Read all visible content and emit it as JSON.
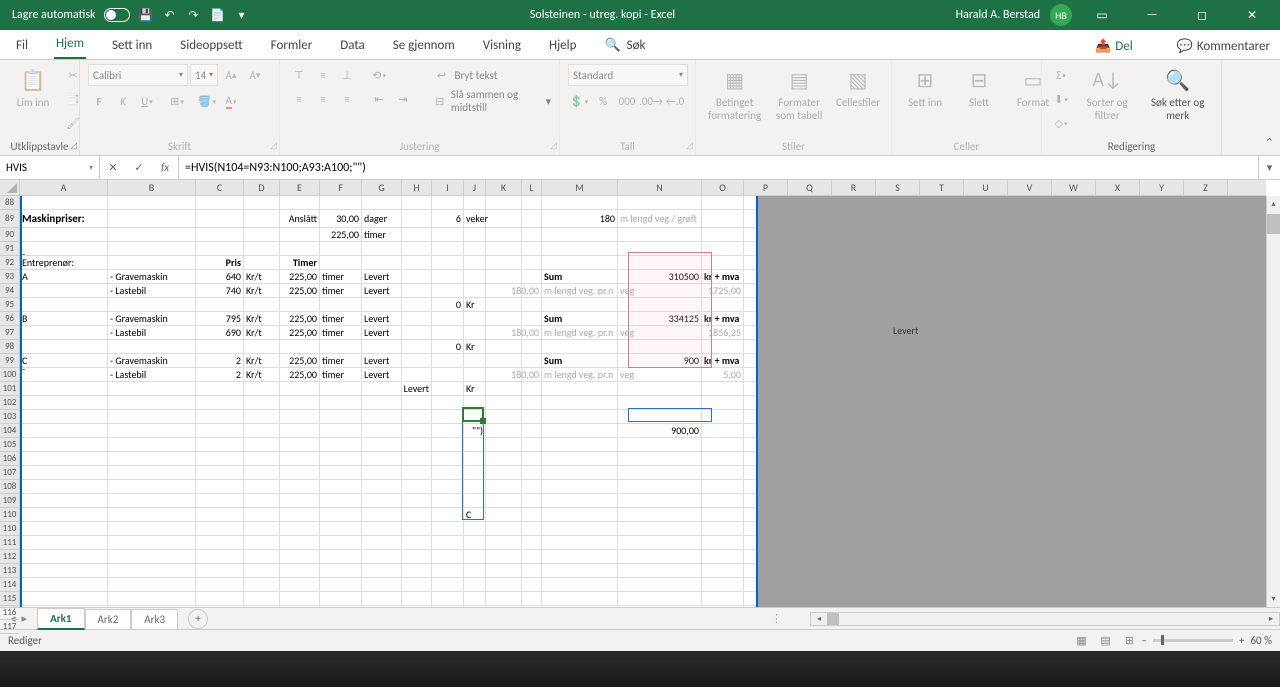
{
  "title": {
    "autosave": "Lagre automatisk",
    "file": "Solsteinen - utreg. kopi  -  Excel",
    "user": "Harald A. Berstad",
    "initials": "HB"
  },
  "tabs": {
    "fil": "Fil",
    "hjem": "Hjem",
    "settinn": "Sett inn",
    "sideoppsett": "Sideoppsett",
    "formler": "Formler",
    "data": "Data",
    "segjennom": "Se gjennom",
    "visning": "Visning",
    "hjelp": "Hjelp",
    "sok": "Søk",
    "del": "Del",
    "kommentarer": "Kommentarer"
  },
  "ribbon": {
    "utklipp": {
      "label": "Utklippstavle",
      "lim": "Lim inn"
    },
    "skrift": {
      "label": "Skrift",
      "font": "Calibri",
      "size": "14"
    },
    "justering": {
      "label": "Justering",
      "bryt": "Bryt tekst",
      "slaa": "Slå sammen og midtstill"
    },
    "tall": {
      "label": "Tall",
      "format": "Standard"
    },
    "stiler": {
      "label": "Stiler",
      "betinget": "Betinget formatering",
      "formater": "Formater som tabell",
      "celle": "Cellestiler"
    },
    "celler": {
      "label": "Celler",
      "settinn": "Sett inn",
      "slett": "Slett",
      "format": "Format"
    },
    "redigering": {
      "label": "Redigering",
      "sorter": "Sorter og filtrer",
      "sok": "Søk etter og merk"
    }
  },
  "namebox": "HVIS",
  "formula": "=HVIS(N104=N93:N100;A93:A100;\"\")",
  "cols": [
    "A",
    "B",
    "C",
    "D",
    "E",
    "F",
    "G",
    "H",
    "I",
    "J",
    "K",
    "L",
    "M",
    "N",
    "O",
    "P",
    "Q",
    "R",
    "S",
    "T",
    "U",
    "V",
    "W",
    "X",
    "Y",
    "Z"
  ],
  "rows": [
    "88",
    "89",
    "90",
    "91",
    "92",
    "93",
    "94",
    "95",
    "96",
    "97",
    "98",
    "99",
    "100",
    "101",
    "102",
    "103",
    "104",
    "105",
    "106",
    "107",
    "108",
    "109",
    "110",
    "110",
    "111",
    "112",
    "113",
    "114",
    "115",
    "116",
    "117"
  ],
  "grid": {
    "maskinpriser": "Maskinpriser:",
    "anslaat": "Anslått",
    "dager": "30,00",
    "dager_l": "dager",
    "veker": "6",
    "veker_l": "veker",
    "lengd": "180",
    "lengd_l": "m lengd veg / grøft",
    "timer_h": "225,00",
    "timer_l": "timer",
    "entreprenor": "Entreprenør:",
    "pris": "Pris",
    "timer": "Timer",
    "a": "A",
    "b": "B",
    "c": "C",
    "gravemaskin": "- Gravemaskin",
    "lastebil": "- Lastebil",
    "p640": "640",
    "p740": "740",
    "p795": "795",
    "p690": "690",
    "p2": "2",
    "krt": "Kr/t",
    "t225": "225,00",
    "tl": "timer",
    "levert": "Levert",
    "zero": "0",
    "kr": "Kr",
    "sum": "Sum",
    "lengdveg": "180,00",
    "lengdveg_l": "m lengd veg. pr.n",
    "veg": "veg",
    "n93": "310500",
    "n96": "334125",
    "n99": "900",
    "krmva": "kr + mva",
    "o94": "1725,00",
    "o97": "1856,25",
    "o100": "5,00",
    "n104": "900,00",
    "j104": "\"\")",
    "j110c": "C",
    "levert_far": "Levert"
  },
  "sheets": {
    "ark1": "Ark1",
    "ark2": "Ark2",
    "ark3": "Ark3"
  },
  "status": {
    "mode": "Rediger",
    "zoom": "60 %"
  }
}
